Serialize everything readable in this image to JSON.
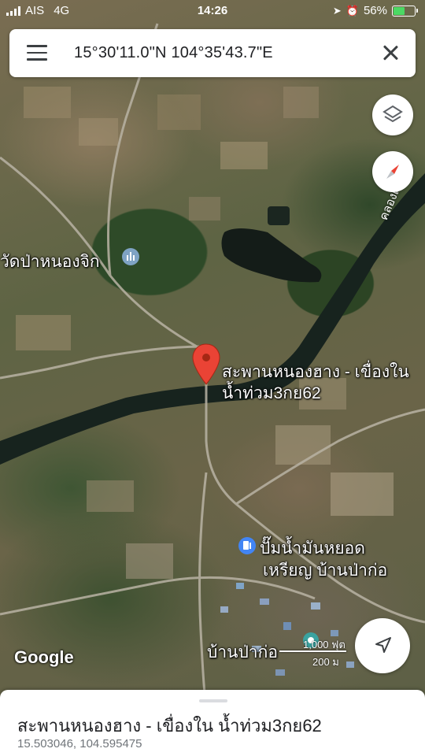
{
  "status_bar": {
    "carrier": "AIS",
    "network": "4G",
    "time": "14:26",
    "battery": "56%",
    "battery_level": 0.56,
    "battery_color": "#4cd964"
  },
  "search": {
    "query": "15°30'11.0\"N 104°35'43.7\"E",
    "menu_icon": "menu-icon",
    "close_icon": "close-icon"
  },
  "map_labels": {
    "temple": "วัดป่าหนองจิก",
    "canal": "คลองเชียง",
    "bridge_line1": "สะพานหนองฮาง - เขื่องใน",
    "bridge_line2": "น้ำท่วม3กย62",
    "gas_line1": "ปั๊มน้ำมันหยอด",
    "gas_line2": "เหรียญ บ้านป่าก่อ",
    "village": "บ้านป่าก่อ"
  },
  "attribution": "Google",
  "scale": {
    "feet": "1,000 ฟุต",
    "meters": "200 ม"
  },
  "controls": {
    "layers_icon": "layers-icon",
    "compass_icon": "compass-icon",
    "locate_icon": "navigation-arrow-icon"
  },
  "place_card": {
    "title": "สะพานหนองฮาง - เขื่องใน น้ำท่วม3กย62",
    "coordinates": "15.503046, 104.595475"
  },
  "colors": {
    "pin": "#ea4335",
    "river": "#17231e",
    "road": "#b9b3a4",
    "gas_marker": "#4285f4"
  }
}
